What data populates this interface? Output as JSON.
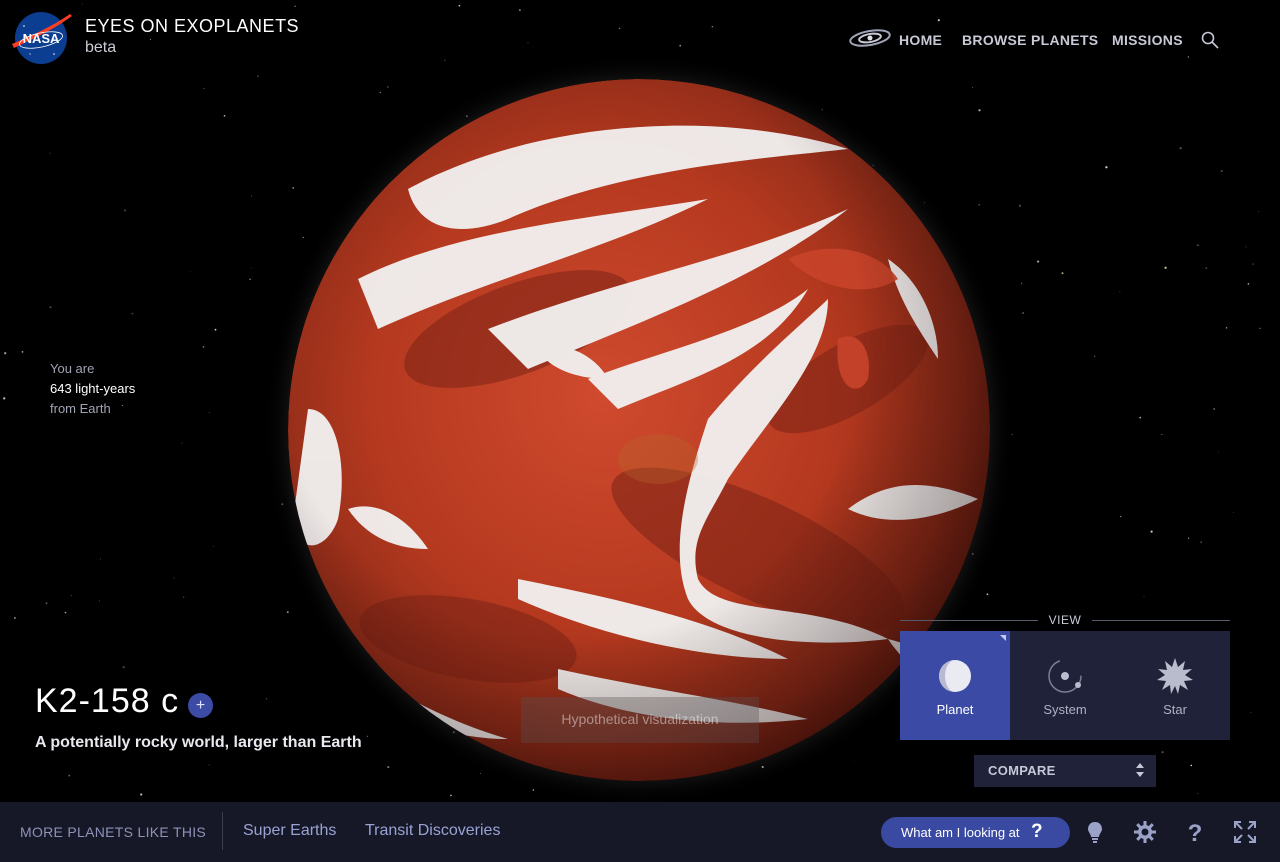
{
  "header": {
    "logo_text": "NASA",
    "title": "EYES ON EXOPLANETS",
    "subtitle": "beta",
    "nav": {
      "home": "HOME",
      "browse": "BROWSE PLANETS",
      "missions": "MISSIONS"
    },
    "icons": [
      "galaxy-icon",
      "search-icon"
    ]
  },
  "distance": {
    "line1": "You are",
    "value": "643 light-years",
    "line3": "from Earth"
  },
  "planet": {
    "name": "K2-158 c",
    "plus_label": "+",
    "description": "A potentially rocky world, larger than Earth",
    "overlay_note": "Hypothetical visualization"
  },
  "view_panel": {
    "label": "VIEW",
    "options": [
      {
        "label": "Planet",
        "icon": "planet-icon",
        "active": true
      },
      {
        "label": "System",
        "icon": "system-icon",
        "active": false
      },
      {
        "label": "Star",
        "icon": "star-icon",
        "active": false
      }
    ],
    "compare_label": "COMPARE"
  },
  "footer": {
    "more_label": "MORE PLANETS LIKE THIS",
    "links": [
      "Super Earths",
      "Transit Discoveries"
    ],
    "what_label": "What am I looking at",
    "what_q": "?",
    "icons": [
      "lightbulb-icon",
      "settings-icon",
      "help-icon",
      "fullscreen-icon"
    ]
  },
  "colors": {
    "accent": "#3b4aa4",
    "panel": "#1f2238",
    "footer": "#161827",
    "planet": "#b83a25"
  }
}
